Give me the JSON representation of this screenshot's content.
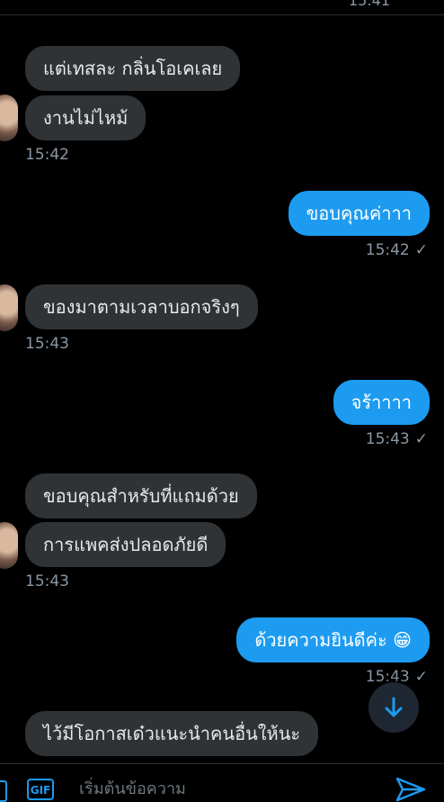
{
  "top_clipped_time": "15:41",
  "messages": [
    {
      "text": "แต่เทสละ กลิ่นโอเคเลย",
      "side": "in"
    },
    {
      "text": "งานไม่ไหม้",
      "side": "in"
    },
    {
      "time": "15:42"
    },
    {
      "text": "ขอบคุณค่าาา",
      "side": "out"
    },
    {
      "time": "15:42"
    },
    {
      "text": "ของมาตามเวลาบอกจริงๆ",
      "side": "in"
    },
    {
      "time": "15:43"
    },
    {
      "text": "จร้าาาา",
      "side": "out"
    },
    {
      "time": "15:43"
    },
    {
      "text": "ขอบคุณสำหรับที่แถมด้วย",
      "side": "in"
    },
    {
      "text": "การแพคส่งปลอดภัยดี",
      "side": "in"
    },
    {
      "time": "15:43"
    },
    {
      "text": "ด้วยความยินดีค่ะ 😁",
      "side": "out"
    },
    {
      "time": "15:43"
    },
    {
      "text": "ไว้มีโอกาสเด๋วแนะนำคนอื่นให้นะ",
      "side": "in"
    }
  ],
  "read_check": "✓",
  "composer": {
    "gif_label": "GIF",
    "placeholder": "เริ่มต้นข้อความ"
  },
  "colors": {
    "background": "#000000",
    "incoming": "#2f3336",
    "outgoing": "#1d9bf0",
    "muted": "#8b98a5"
  },
  "icons": [
    "down-arrow-icon",
    "gif-icon",
    "image-icon",
    "send-icon"
  ]
}
